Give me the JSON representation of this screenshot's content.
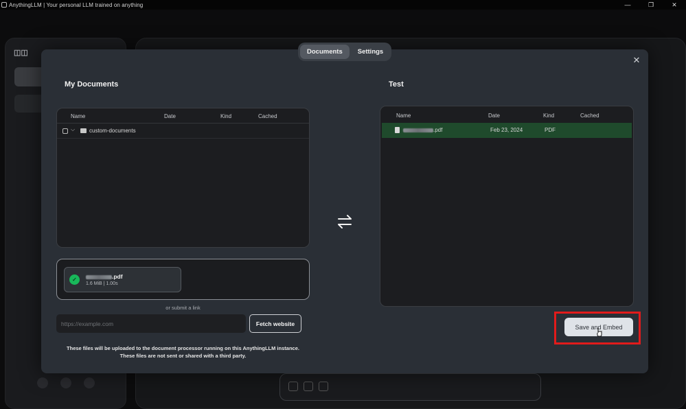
{
  "window": {
    "title": "AnythingLLM | Your personal LLM trained on anything",
    "controls": [
      "—",
      "❐",
      "✕"
    ]
  },
  "tabs": [
    {
      "label": "Documents",
      "active": true
    },
    {
      "label": "Settings",
      "active": false
    }
  ],
  "my_documents": {
    "title": "My Documents",
    "columns": [
      "Name",
      "Date",
      "Kind",
      "Cached"
    ],
    "rows": [
      {
        "name": "custom-documents",
        "type": "folder"
      }
    ]
  },
  "workspace": {
    "title": "Test",
    "columns": [
      "Name",
      "Date",
      "Kind",
      "Cached"
    ],
    "rows": [
      {
        "name_suffix": ".pdf",
        "date": "Feb 23, 2024",
        "kind": "PDF",
        "cached": ""
      }
    ]
  },
  "upload": {
    "file_suffix": ".pdf",
    "file_meta": "1.6 MiB | 1.00s",
    "or_link_text": "or submit a link",
    "url_placeholder": "https://example.com",
    "fetch_label": "Fetch website",
    "notice_line1": "These files will be uploaded to the document processor running on this AnythingLLM instance.",
    "notice_line2": "These files are not sent or shared with a third party."
  },
  "save_label": "Save and Embed",
  "colors": {
    "modal_bg": "#2a2f36",
    "selected_row": "#1f4a2c",
    "highlight": "#e21b1b",
    "success": "#18b85a"
  }
}
